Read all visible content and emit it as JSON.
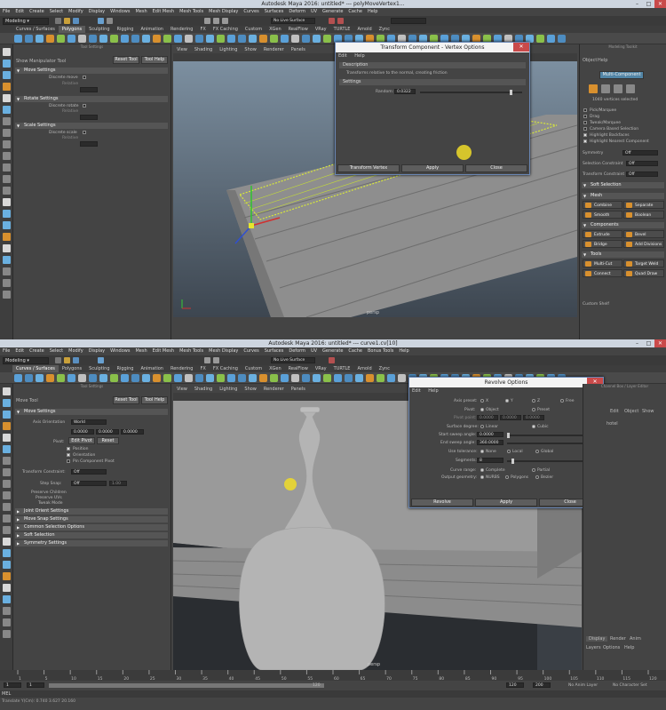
{
  "colors": {
    "accent": "#d8902e",
    "select_blue": "#5285a6",
    "dialog_border": "#6a87b5",
    "highlight": "#f0dc28"
  },
  "top": {
    "title": "Autodesk Maya 2016: untitled*   ---   polyMoveVertex1...",
    "menu": [
      "File",
      "Edit",
      "Create",
      "Select",
      "Modify",
      "Display",
      "Windows",
      "Mesh",
      "Edit Mesh",
      "Mesh Tools",
      "Mesh Display",
      "Curves",
      "Surfaces",
      "Deform",
      "UV",
      "Generate",
      "Cache",
      "Help"
    ],
    "mode": "Modeling",
    "live_surface": "No Live Surface",
    "shelf_tabs": [
      "Curves / Surfaces",
      "Polygons",
      "Sculpting",
      "Rigging",
      "Animation",
      "Rendering",
      "FX",
      "FX Caching",
      "Custom",
      "XGen",
      "RealFlow",
      "VRay",
      "TURTLE",
      "Arnold",
      "Zync"
    ],
    "active_tab": "Polygons",
    "tool_settings": {
      "panel_title": "Tool Settings",
      "tool_name": "Show Manipulator Tool",
      "reset": "Reset Tool",
      "help": "Tool Help",
      "sections": [
        {
          "name": "Move Settings",
          "label": "Discrete move",
          "sub": "Relative"
        },
        {
          "name": "Rotate Settings",
          "label": "Discrete rotate",
          "sub": "Relative"
        },
        {
          "name": "Scale Settings",
          "label": "Discrete scale",
          "sub": "Relative"
        }
      ]
    },
    "viewport": {
      "menu": [
        "View",
        "Shading",
        "Lighting",
        "Show",
        "Renderer",
        "Panels"
      ],
      "camera": "persp"
    },
    "dialog": {
      "title": "Transform Component - Vertex Options",
      "menu": [
        "Edit",
        "Help"
      ],
      "description_header": "Description",
      "description": "Transforms relative to the normal, creating friction",
      "settings_header": "Settings",
      "random_label": "Random:",
      "random_value": "0.0322",
      "random_fraction": 0.9,
      "buttons": [
        "Transform Vertex",
        "Apply",
        "Close"
      ]
    },
    "modeling_toolkit": {
      "title": "Modeling Toolkit",
      "tabs": [
        "Object",
        "Help"
      ],
      "multi_component": "Multi-Component",
      "selected_count": "1040 vertices selected",
      "options": [
        "Pick/Marquee",
        "Drag",
        "Tweak/Marquee",
        "Camera Based Selection",
        "Highlight Backfaces",
        "Highlight Nearest Component"
      ],
      "options_checked": [
        false,
        false,
        false,
        false,
        true,
        true
      ],
      "symmetry_label": "Symmetry",
      "symmetry_value": "Off",
      "selection_constraint_label": "Selection Constraint",
      "selection_constraint_value": "Off",
      "transform_constraint_label": "Transform Constraint",
      "transform_constraint_value": "Off",
      "soft_selection": "Soft Selection",
      "mesh_header": "Mesh",
      "mesh_buttons": [
        "Combine",
        "Separate",
        "Smooth",
        "Boolean"
      ],
      "components_header": "Components",
      "component_buttons": [
        "Extrude",
        "Bevel",
        "Bridge",
        "Add Divisions"
      ],
      "tools_header": "Tools",
      "tool_buttons": [
        "Multi-Cut",
        "Target Weld",
        "Connect",
        "Quad Draw"
      ],
      "custom_shelf": "Custom Shelf"
    }
  },
  "bottom": {
    "title": "Autodesk Maya 2016: untitled*   ---   curve1.cv[10]",
    "menu": [
      "File",
      "Edit",
      "Create",
      "Select",
      "Modify",
      "Display",
      "Windows",
      "Mesh",
      "Edit Mesh",
      "Mesh Tools",
      "Mesh Display",
      "Curves",
      "Surfaces",
      "Deform",
      "UV",
      "Generate",
      "Cache",
      "Bonus Tools",
      "Help"
    ],
    "mode": "Modeling",
    "live_surface": "No Live Surface",
    "shelf_tabs": [
      "Curves / Surfaces",
      "Polygons",
      "Sculpting",
      "Rigging",
      "Animation",
      "Rendering",
      "FX",
      "FX Caching",
      "Custom",
      "XGen",
      "RealFlow",
      "VRay",
      "TURTLE",
      "Arnold",
      "Zync"
    ],
    "active_tab": "Curves / Surfaces",
    "tool_settings": {
      "panel_title": "Tool Settings",
      "tool_name": "Move Tool",
      "reset": "Reset Tool",
      "help": "Tool Help",
      "move_settings": "Move Settings",
      "axis_orientation_label": "Axis Orientation",
      "axis_orientation_value": "World",
      "xyz": [
        "0.0000",
        "0.0000",
        "0.0000"
      ],
      "pivot_label": "Pivot:",
      "edit_pivot": "Edit Pivot",
      "reset_pivot": "Reset",
      "pivot_checks": [
        "Position",
        "Orientation",
        "Pin Component Pivot"
      ],
      "pivot_checked": [
        true,
        true,
        false
      ],
      "transform_constraint_label": "Transform Constraint:",
      "transform_constraint_value": "Off",
      "step_snap_label": "Step Snap:",
      "step_snap_value": "Off",
      "step_snap_num": "1.00",
      "extra_labels": [
        "Preserve Children",
        "Preserve UVs",
        "Tweak Mode"
      ],
      "collapsed_sections": [
        "Joint Orient Settings",
        "Move Snap Settings",
        "Common Selection Options",
        "Soft Selection",
        "Symmetry Settings"
      ]
    },
    "viewport": {
      "menu": [
        "View",
        "Shading",
        "Lighting",
        "Show",
        "Renderer",
        "Panels"
      ],
      "camera": "persp"
    },
    "dialog": {
      "title": "Revolve Options",
      "menu": [
        "Edit",
        "Help"
      ],
      "axis_preset_label": "Axis preset:",
      "axis_preset_options": [
        "X",
        "Y",
        "Z",
        "Free"
      ],
      "axis_preset_selected": 1,
      "pivot_label": "Pivot:",
      "pivot_options": [
        "Object",
        "Preset"
      ],
      "pivot_point_label": "Pivot point:",
      "pivot_point_values": [
        "0.0000",
        "0.0000",
        "0.0000"
      ],
      "surface_degree_label": "Surface degree:",
      "surface_degree_options": [
        "Linear",
        "Cubic"
      ],
      "surface_degree_selected": 1,
      "start_sweep_label": "Start sweep angle:",
      "start_sweep_value": "0.0000",
      "start_sweep_fraction": 0.0,
      "end_sweep_label": "End sweep angle:",
      "end_sweep_value": "360.0000",
      "end_sweep_fraction": 1.0,
      "use_tolerance_label": "Use tolerance:",
      "use_tolerance_options": [
        "None",
        "Local",
        "Global"
      ],
      "segments_label": "Segments:",
      "segments_value": "8",
      "curve_range_label": "Curve range:",
      "curve_range_options": [
        "Complete",
        "Partial"
      ],
      "output_geometry_label": "Output geometry:",
      "output_geometry_options": [
        "NURBS",
        "Polygons",
        "Bezier"
      ],
      "buttons": [
        "Revolve",
        "Apply",
        "Close"
      ]
    },
    "right_panel": {
      "title": "Channel Box / Layer Editor",
      "tabs": [
        "Edit",
        "Object",
        "Show"
      ],
      "item": "hotel",
      "layer_tabs": [
        "Display",
        "Render",
        "Anim"
      ],
      "layer_menu": [
        "Layers",
        "Options",
        "Help"
      ]
    },
    "timeline": {
      "ticks": [
        "1",
        "5",
        "10",
        "15",
        "20",
        "25",
        "30",
        "35",
        "40",
        "45",
        "50",
        "55",
        "60",
        "65",
        "70",
        "75",
        "80",
        "85",
        "90",
        "95",
        "100",
        "105",
        "110",
        "115",
        "120"
      ]
    },
    "range": {
      "start": "1",
      "field1": "1",
      "mid": "120",
      "end1": "120",
      "end2": "200",
      "anim_layer": "No Anim Layer",
      "char_set": "No Character Set"
    },
    "cmd_label": "MEL",
    "help_line": "Translate Y(Cm):       0.740        3.627        20.160"
  }
}
